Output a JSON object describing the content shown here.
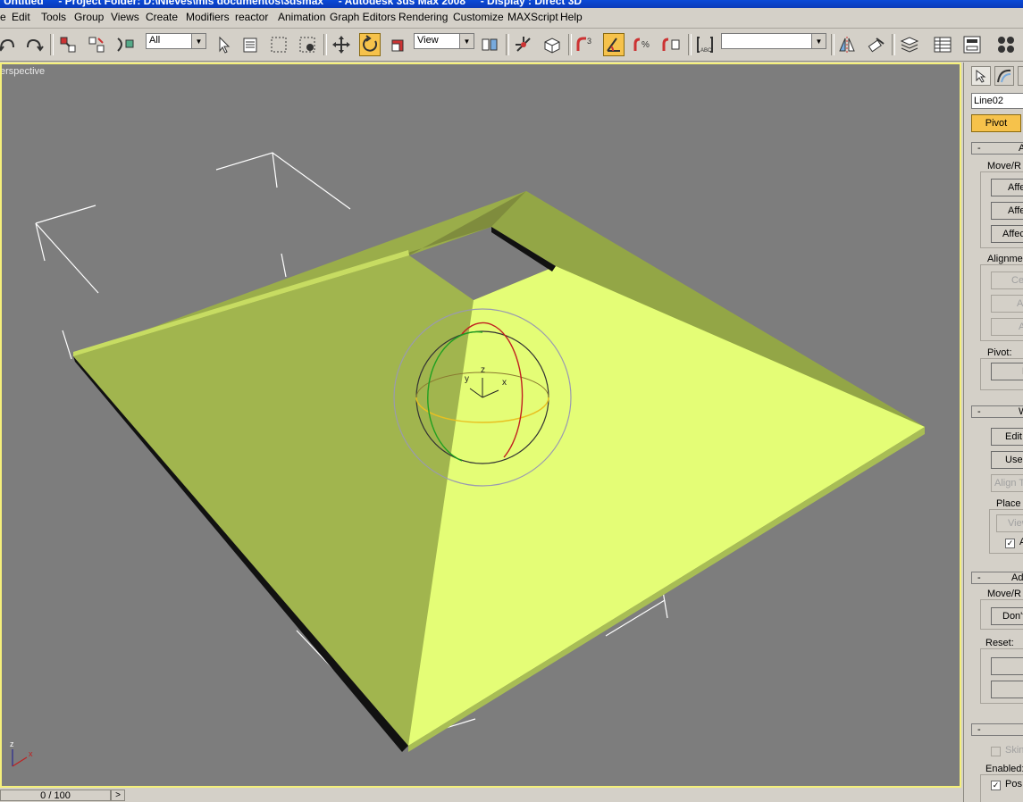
{
  "title": "Untitled     - Project Folder: D:\\Nieves\\mis documentos\\3dsmax     - Autodesk 3ds Max 2008     - Display : Direct 3D",
  "menu": [
    "e",
    "Edit",
    "Tools",
    "Group",
    "Views",
    "Create",
    "Modifiers",
    "reactor",
    "Animation",
    "Graph Editors",
    "Rendering",
    "Customize",
    "MAXScript",
    "Help"
  ],
  "toolbar": {
    "selection_filter": "All",
    "reference_coord": "View",
    "named_selection": "",
    "icons": [
      "undo-icon",
      "redo-icon",
      "select-link-icon",
      "unlink-icon",
      "bind-spacewarp-icon",
      "select-icon",
      "select-by-name-icon",
      "rect-region-icon",
      "window-crossing-icon",
      "move-icon",
      "rotate-icon",
      "scale-icon",
      "pivot-center-icon",
      "select-manipulate-icon",
      "keyboard-shortcut-icon",
      "snap-3-icon",
      "angle-snap-icon",
      "percent-snap-icon",
      "spinner-snap-icon",
      "edit-named-selections-icon",
      "mirror-icon",
      "align-icon",
      "layer-manager-icon",
      "curve-editor-icon",
      "schematic-view-icon",
      "material-editor-icon"
    ]
  },
  "viewport": {
    "label": "erspective",
    "gizmo_labels": {
      "z": "z",
      "y": "y",
      "x": "x"
    },
    "axis_labels": {
      "z": "z",
      "x": "x"
    },
    "colors": {
      "background": "#7d7d7d",
      "border": "#f5f07a",
      "face_lit": "#e4fd76",
      "face_shade": "#9aad4a",
      "wire": "#ffffff"
    }
  },
  "timeline": {
    "frame": "0 / 100",
    "next": ">"
  },
  "panel": {
    "object_name": "Line02",
    "pivot_button": "Pivot",
    "rollouts": [
      {
        "minus": "-",
        "title": "A"
      },
      {
        "minus": "-",
        "title": "W"
      },
      {
        "minus": "-",
        "title": "Adj"
      },
      {
        "minus": "-",
        "title": ""
      }
    ],
    "groups": {
      "move_rotate": "Move/R",
      "alignment": "Alignmer",
      "pivot": "Pivot:",
      "place": "Place",
      "move_rotate2": "Move/R",
      "reset": "Reset:",
      "enabled": "Enabled:"
    },
    "buttons": {
      "affect1": "Affe",
      "affect2": "Affe",
      "affect3": "Affec",
      "center": "Ce",
      "align": "Al",
      "a": "A",
      "reset_pivot": "R",
      "edit": "Edit",
      "use": "Use",
      "align_t": "Align T",
      "view": "View",
      "dont": "Don't",
      "reset1": "",
      "reset2": ""
    },
    "checks": {
      "a_label": "A",
      "skin_label": "Skin",
      "pos_label": "Pos",
      "a_checked": "✓",
      "pos_checked": "✓"
    }
  }
}
